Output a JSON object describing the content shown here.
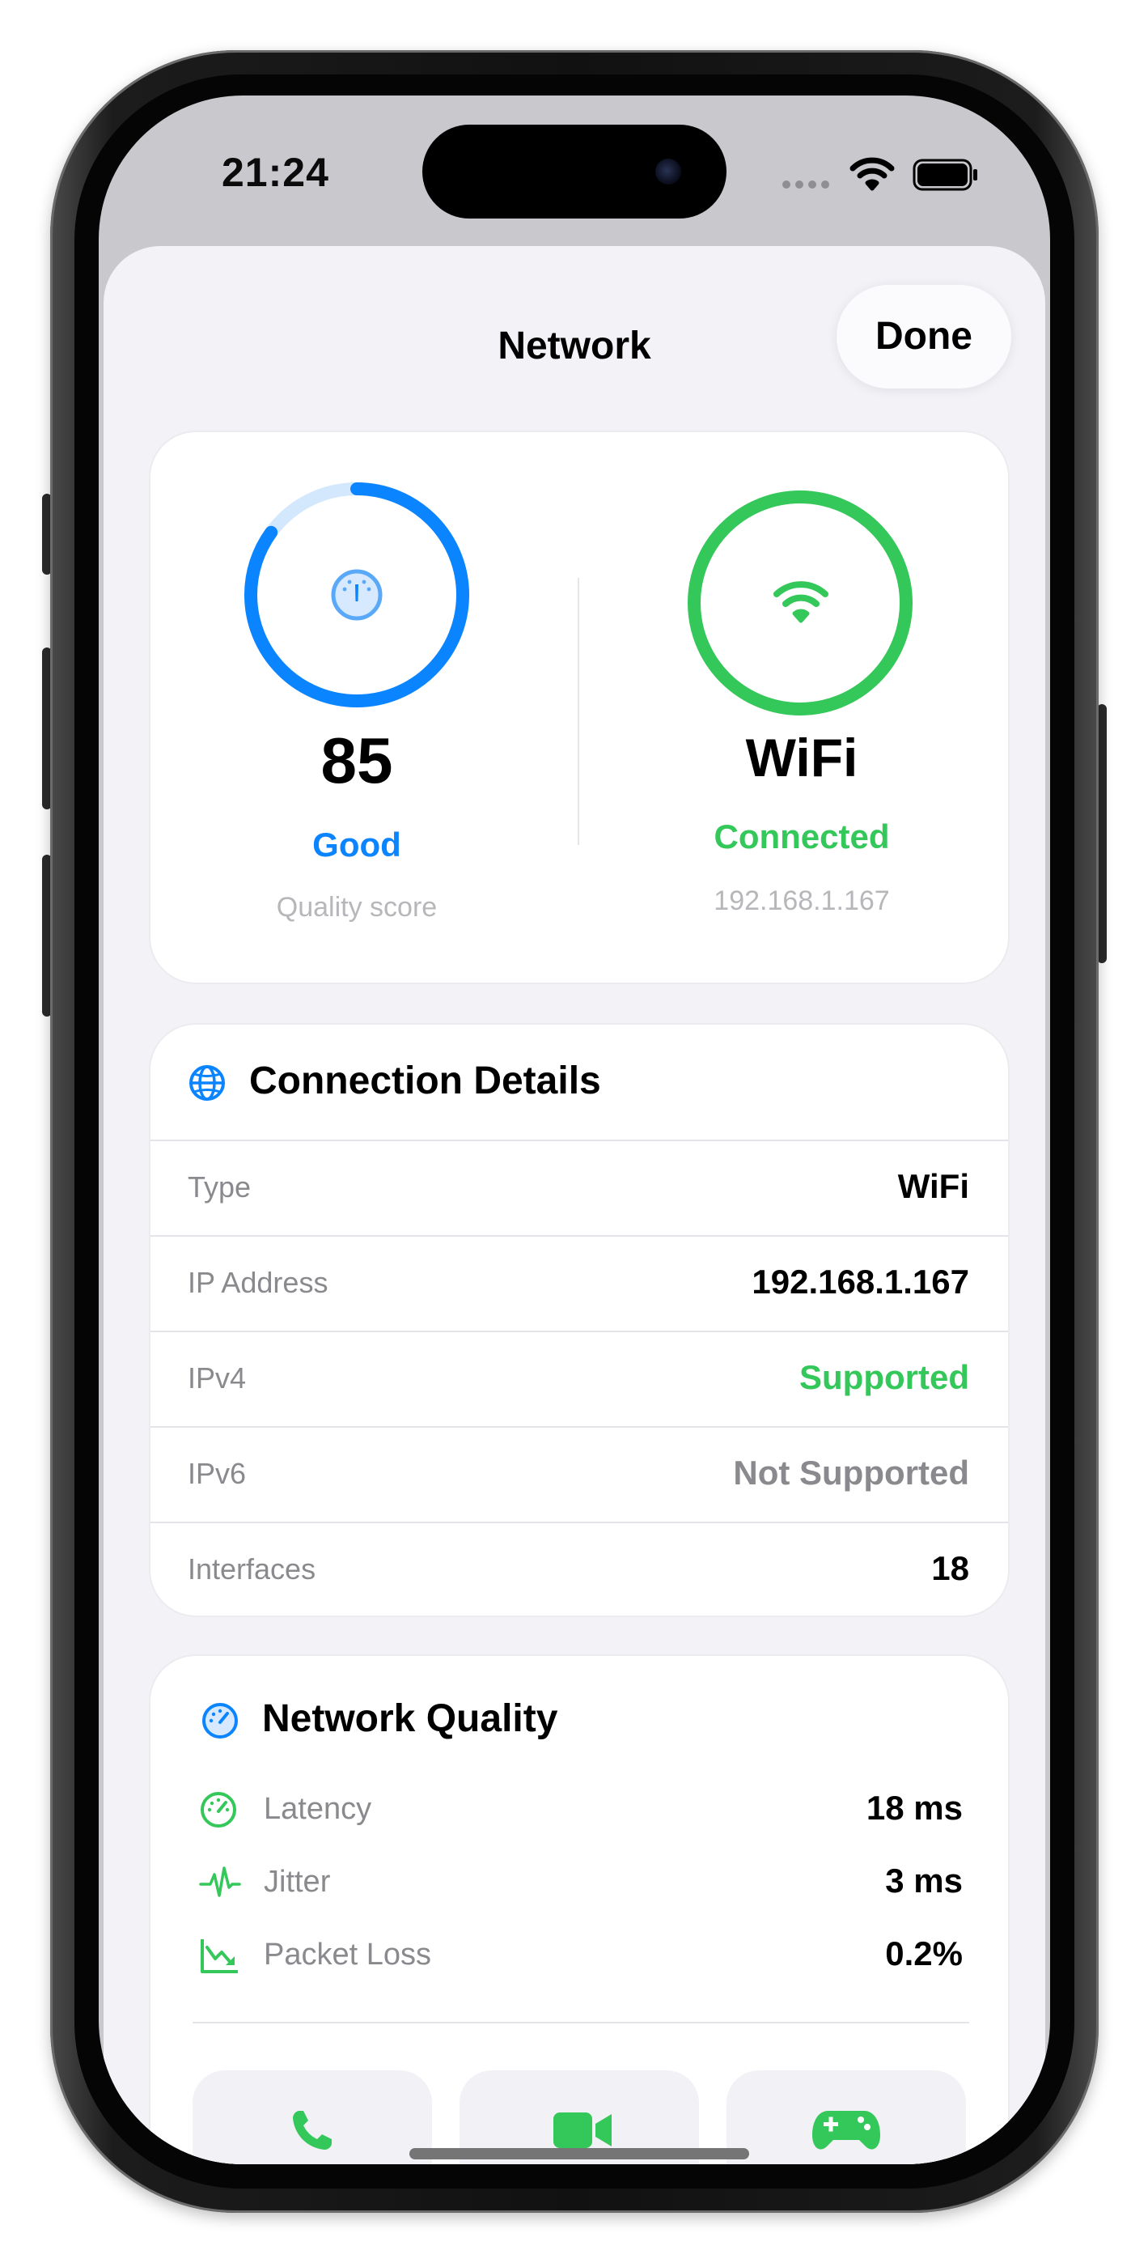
{
  "status_bar": {
    "time": "21:24"
  },
  "sheet": {
    "title": "Network",
    "done_label": "Done"
  },
  "summary": {
    "quality": {
      "score": "85",
      "score_value": 0.85,
      "rating": "Good",
      "caption": "Quality score"
    },
    "connection": {
      "type": "WiFi",
      "status": "Connected",
      "ip": "192.168.1.167"
    }
  },
  "details": {
    "title": "Connection Details",
    "rows": [
      {
        "label": "Type",
        "value": "WiFi"
      },
      {
        "label": "IP Address",
        "value": "192.168.1.167"
      },
      {
        "label": "IPv4",
        "value": "Supported"
      },
      {
        "label": "IPv6",
        "value": "Not Supported"
      },
      {
        "label": "Interfaces",
        "value": "18"
      }
    ]
  },
  "quality": {
    "title": "Network Quality",
    "metrics": [
      {
        "label": "Latency",
        "value": "18 ms",
        "icon": "speedometer-icon"
      },
      {
        "label": "Jitter",
        "value": "3 ms",
        "icon": "waveform-icon"
      },
      {
        "label": "Packet Loss",
        "value": "0.2%",
        "icon": "chart-down-icon"
      }
    ],
    "tiles": [
      {
        "icon": "phone-icon"
      },
      {
        "icon": "video-icon"
      },
      {
        "icon": "gamecontroller-icon"
      }
    ]
  },
  "colors": {
    "blue": "#0a84ff",
    "green": "#34c759",
    "gray_text": "#8a8a8e"
  }
}
